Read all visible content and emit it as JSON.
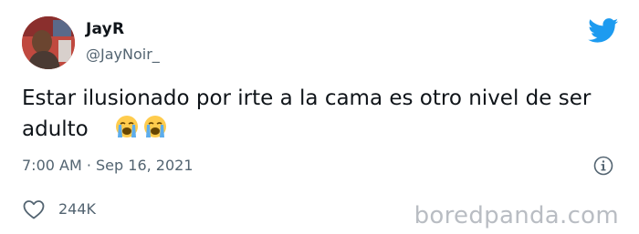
{
  "author": {
    "display_name": "JayR",
    "handle": "@JayNoir_",
    "avatar_icon": "user-avatar"
  },
  "brand": {
    "icon": "twitter-bird-icon",
    "color": "#1d9bf0"
  },
  "tweet": {
    "text": "Estar ilusionado por irte a la cama es otro nivel de ser adulto",
    "emojis": [
      "😭",
      "😭"
    ],
    "timestamp": "7:00 AM · Sep 16, 2021"
  },
  "engagement": {
    "like_icon": "heart-icon",
    "like_count": "244K",
    "info_icon": "info-icon"
  },
  "watermark": {
    "text": "boredpanda.com"
  },
  "colors": {
    "text_primary": "#0f1419",
    "text_secondary": "#536471",
    "watermark": "#b9bdc3"
  }
}
